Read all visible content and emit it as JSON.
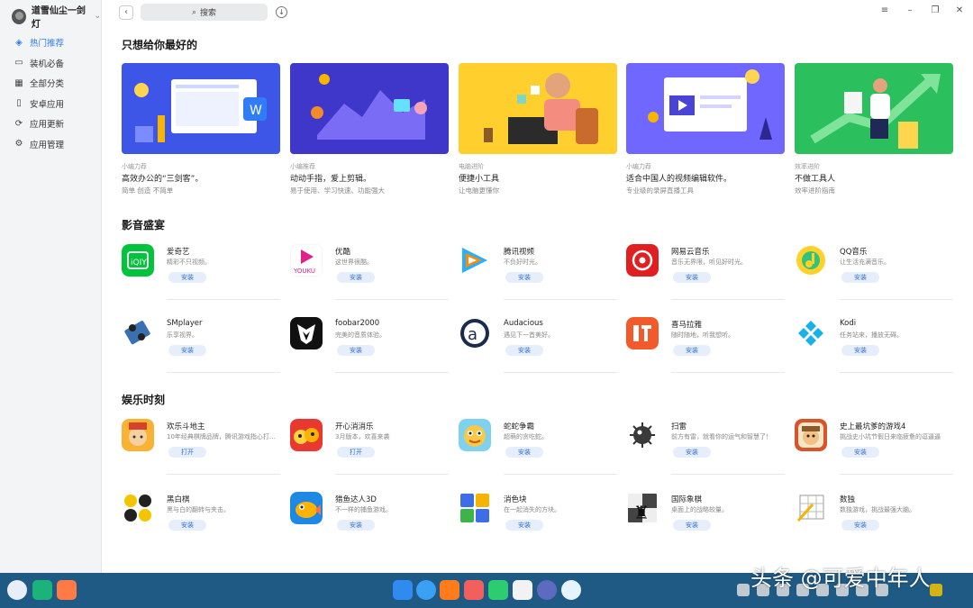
{
  "user": {
    "name": "道雪仙尘一剑灯"
  },
  "sidebar": {
    "items": [
      {
        "label": "热门推荐",
        "active": true,
        "icon": "compass-icon"
      },
      {
        "label": "装机必备",
        "active": false,
        "icon": "monitor-icon"
      },
      {
        "label": "全部分类",
        "active": false,
        "icon": "grid-icon"
      },
      {
        "label": "安卓应用",
        "active": false,
        "icon": "phone-icon"
      },
      {
        "label": "应用更新",
        "active": false,
        "icon": "refresh-icon"
      },
      {
        "label": "应用管理",
        "active": false,
        "icon": "gear-icon"
      }
    ]
  },
  "search": {
    "label": "搜索"
  },
  "sections": {
    "featured": "只想给你最好的",
    "media": "影音盛宴",
    "games": "娱乐时刻"
  },
  "banners": [
    {
      "tag": "小编力荐",
      "title": "高效办公的“三剑客”。",
      "sub": "简单 创造 不简单"
    },
    {
      "tag": "小编推荐",
      "title": "动动手指，爱上剪辑。",
      "sub": "易于使用、学习快速、功能强大"
    },
    {
      "tag": "电脑进阶",
      "title": "便捷小工具",
      "sub": "让电脑更懂你"
    },
    {
      "tag": "小编力荐",
      "title": "适合中国人的视频编辑软件。",
      "sub": "专业级的录屏直播工具"
    },
    {
      "tag": "效率进阶",
      "title": "不做工具人",
      "sub": "效率进阶指南"
    }
  ],
  "media_apps": [
    {
      "name": "爱奇艺",
      "desc": "精彩不只视频。",
      "button": "安装"
    },
    {
      "name": "优酷",
      "desc": "这世界很酷。",
      "button": "安装"
    },
    {
      "name": "腾讯视频",
      "desc": "不负好时光。",
      "button": "安装"
    },
    {
      "name": "网易云音乐",
      "desc": "音乐无界限，听见好时光。",
      "button": "安装"
    },
    {
      "name": "QQ音乐",
      "desc": "让生活充满音乐。",
      "button": "安装"
    },
    {
      "name": "SMplayer",
      "desc": "乐享视界。",
      "button": "安装"
    },
    {
      "name": "foobar2000",
      "desc": "完美的音质体验。",
      "button": "安装"
    },
    {
      "name": "Audacious",
      "desc": "遇见下一首美好。",
      "button": "安装"
    },
    {
      "name": "喜马拉雅",
      "desc": "随时随地，听我想听。",
      "button": "安装"
    },
    {
      "name": "Kodi",
      "desc": "任务站来，播放无碍。",
      "button": "安装"
    }
  ],
  "game_apps": [
    {
      "name": "欢乐斗地主",
      "desc": "10年经典棋牌品牌，腾讯游戏指心打造……",
      "button": "打开"
    },
    {
      "name": "开心消消乐",
      "desc": "3月版本，欢喜来袭",
      "button": "打开"
    },
    {
      "name": "蛇蛇争霸",
      "desc": "超萌的贪吃蛇。",
      "button": "安装"
    },
    {
      "name": "扫雷",
      "desc": "前方有雷，就看你的运气和智慧了！",
      "button": "安装"
    },
    {
      "name": "史上最坑爹的游戏4",
      "desc": "挑战史小坑节假日来临疲惫的逗逼逼",
      "button": "安装"
    },
    {
      "name": "黑白棋",
      "desc": "黑与白的翻转与夹击。",
      "button": "安装"
    },
    {
      "name": "猎鱼达人3D",
      "desc": "不一样的捕鱼游戏。",
      "button": "安装"
    },
    {
      "name": "消色块",
      "desc": "在一起消失的方块。",
      "button": "安装"
    },
    {
      "name": "国际象棋",
      "desc": "桌面上的战略较量。",
      "button": "安装"
    },
    {
      "name": "数独",
      "desc": "数独游戏，挑战最强大脑。",
      "button": "安装"
    }
  ],
  "watermark": "头条 @可爱中年人",
  "colors": {
    "accent": "#2f7cf6",
    "taskbar": "#1f5a84",
    "sidebar": "#f3f4f6"
  }
}
